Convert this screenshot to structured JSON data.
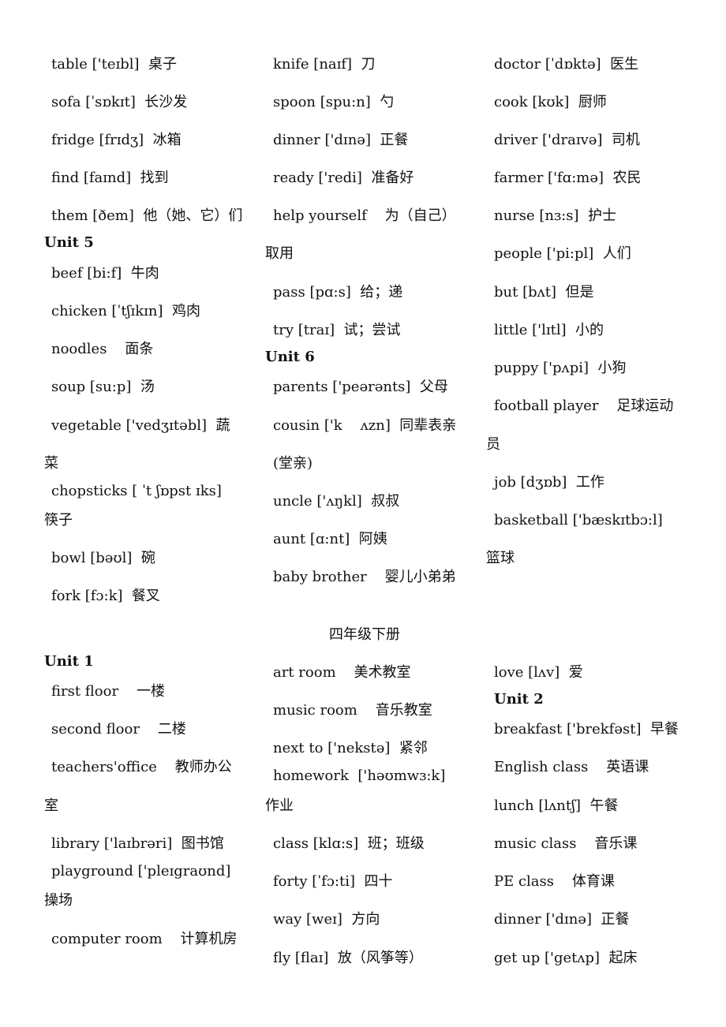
{
  "section_title": "四年级下册",
  "columns": [
    [
      {
        "text": "table ['teɪbl]  桌子"
      },
      {
        "text": "sofa [ˈsɒkɪt]  长沙发"
      },
      {
        "text": "fridge [frɪdʒ]  冰箱"
      },
      {
        "text": "find [faɪnd]  找到"
      },
      {
        "text": "them [ðem]  他（她、它）们"
      },
      {
        "text": "Unit 5",
        "heading": true
      },
      {
        "text": "beef [bi:f]  牛肉"
      },
      {
        "text": "chicken [ˈtʃɪkɪn]  鸡肉"
      },
      {
        "text": "noodles    面条"
      },
      {
        "text": "soup [su:p]  汤"
      },
      {
        "text": "vegetable ['vedʒɪtəbl]  蔬"
      },
      {
        "text": "菜",
        "wrap": true
      },
      {
        "text": "chopsticks [ ˈt ʃɒpst ɪks]"
      },
      {
        "text": "筷子",
        "wrap": true
      },
      {
        "text": "bowl [bəʊl]  碗"
      },
      {
        "text": "fork [fɔ:k]  餐叉"
      },
      {
        "text": "Unit 1",
        "heading": true
      },
      {
        "text": "first floor    一楼"
      },
      {
        "text": "second floor    二楼"
      },
      {
        "text": "teachers'office    教师办公"
      },
      {
        "text": "室",
        "wrap": true
      },
      {
        "text": "library ['laɪbrəri]  图书馆"
      },
      {
        "text": "playground ['pleɪgraʊnd]"
      },
      {
        "text": "操场",
        "wrap": true
      },
      {
        "text": "computer room    计算机房"
      }
    ],
    [
      {
        "text": "knife [naɪf]  刀"
      },
      {
        "text": "spoon [spu:n]  勺"
      },
      {
        "text": "dinner ['dɪnə]  正餐"
      },
      {
        "text": "ready ['redi]  准备好"
      },
      {
        "text": "help yourself    为（自己）"
      },
      {
        "text": "取用",
        "wrap": true
      },
      {
        "text": "pass [pɑ:s]  给；递"
      },
      {
        "text": "try [traɪ]  试；尝试"
      },
      {
        "text": "Unit 6",
        "heading": true
      },
      {
        "text": "parents ['peərənts]  父母"
      },
      {
        "text": "cousin ['k    ʌzn]  同辈表亲"
      },
      {
        "text": "(堂亲)"
      },
      {
        "text": "uncle ['ʌŋkl]  叔叔"
      },
      {
        "text": "aunt [ɑ:nt]  阿姨"
      },
      {
        "text": "baby brother    婴儿小弟弟"
      },
      {
        "text": "art room    美术教室"
      },
      {
        "text": "music room    音乐教室"
      },
      {
        "text": "next to ['nekstə]  紧邻"
      },
      {
        "text": "homework  ['həʊmwɜ:k]"
      },
      {
        "text": "作业",
        "wrap": true
      },
      {
        "text": "class [klɑ:s]  班；班级"
      },
      {
        "text": "forty [ˈfɔ:ti]  四十"
      },
      {
        "text": "way [weɪ]  方向"
      },
      {
        "text": "fly [flaɪ]  放（风筝等）"
      }
    ],
    [
      {
        "text": "doctor [ˈdɒktə]  医生"
      },
      {
        "text": "cook [kʊk]  厨师"
      },
      {
        "text": "driver ['draɪvə]  司机"
      },
      {
        "text": "farmer ['fɑ:mə]  农民"
      },
      {
        "text": "nurse [nɜ:s]  护士"
      },
      {
        "text": "people ['pi:pl]  人们"
      },
      {
        "text": "but [bʌt]  但是"
      },
      {
        "text": "little ['lɪtl]  小的"
      },
      {
        "text": "puppy ['pʌpi]  小狗"
      },
      {
        "text": "football player    足球运动"
      },
      {
        "text": "员",
        "wrap": true
      },
      {
        "text": "job [dʒɒb]  工作"
      },
      {
        "text": "basketball ['bæskɪtbɔ:l]"
      },
      {
        "text": "篮球",
        "wrap": true
      },
      {
        "text": "love [lʌv]  爱"
      },
      {
        "text": "Unit 2",
        "heading": true
      },
      {
        "text": "breakfast ['brekfəst]  早餐"
      },
      {
        "text": "English class    英语课"
      },
      {
        "text": "lunch [lʌntʃ]  午餐"
      },
      {
        "text": "music class    音乐课"
      },
      {
        "text": "PE class    体育课"
      },
      {
        "text": "dinner ['dɪnə]  正餐"
      },
      {
        "text": "get up ['getʌp]  起床"
      }
    ]
  ]
}
